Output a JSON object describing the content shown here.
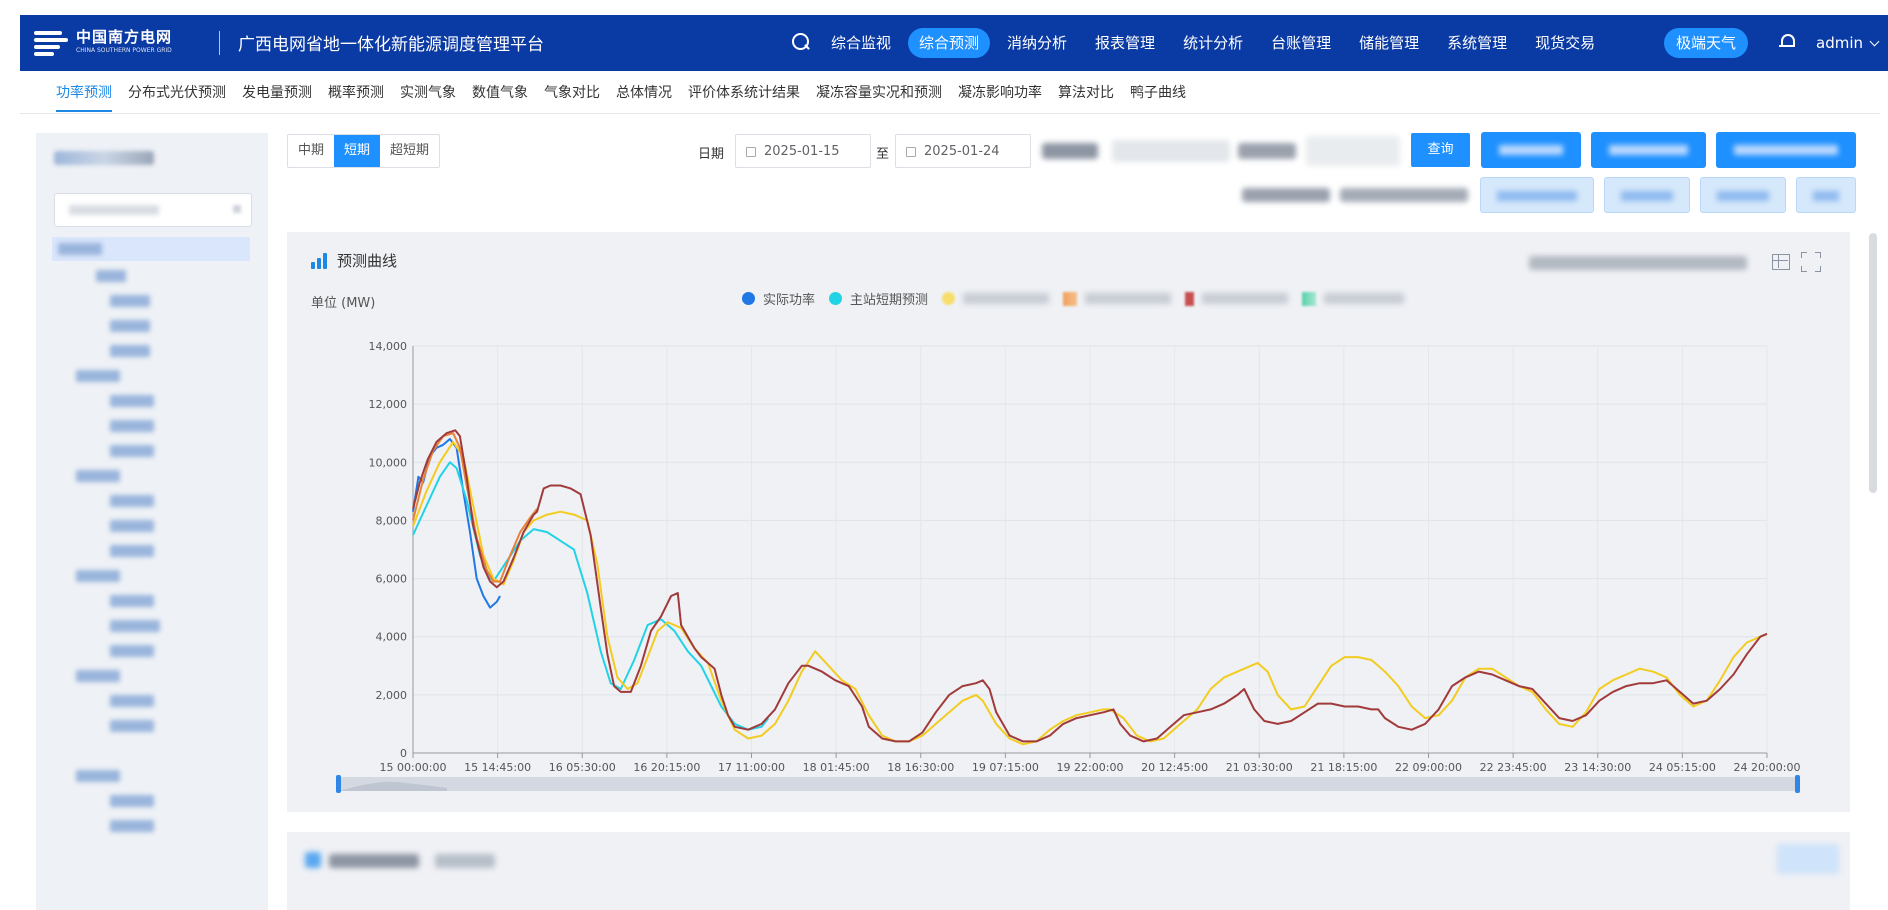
{
  "header": {
    "logo_cn": "中国南方电网",
    "logo_en": "CHINA SOUTHERN POWER GRID",
    "platform_title": "广西电网省地一体化新能源调度管理平台",
    "nav_items": [
      "综合监视",
      "综合预测",
      "消纳分析",
      "报表管理",
      "统计分析",
      "台账管理",
      "储能管理",
      "系统管理",
      "现货交易"
    ],
    "active_nav_index": 1,
    "extreme_weather": "极端天气",
    "user": "admin"
  },
  "subnav": {
    "items": [
      "功率预测",
      "分布式光伏预测",
      "发电量预测",
      "概率预测",
      "实测气象",
      "数值气象",
      "气象对比",
      "总体情况",
      "评价体系统计结果",
      "凝冻容量实况和预测",
      "凝冻影响功率",
      "算法对比",
      "鸭子曲线"
    ],
    "active_index": 0
  },
  "toolbar": {
    "segments": [
      "中期",
      "短期",
      "超短期"
    ],
    "active_segment": 1,
    "date_label": "日期",
    "date_from": "2025-01-15",
    "date_sep": "至",
    "date_to": "2025-01-24",
    "query": "查询"
  },
  "panel": {
    "title": "预测曲线",
    "unit": "单位 (MW)",
    "legend": [
      {
        "name": "实际功率",
        "color": "#1f78e6"
      },
      {
        "name": "主站短期预测",
        "color": "#22d3e6"
      }
    ]
  },
  "chart_data": {
    "type": "line",
    "ylim": [
      0,
      14000
    ],
    "yticks": [
      "0",
      "2,000",
      "4,000",
      "6,000",
      "8,000",
      "10,000",
      "12,000",
      "14,000"
    ],
    "xticks": [
      "15 00:00:00",
      "15 14:45:00",
      "16 05:30:00",
      "16 20:15:00",
      "17 11:00:00",
      "18 01:45:00",
      "18 16:30:00",
      "19 07:15:00",
      "19 22:00:00",
      "20 12:45:00",
      "21 03:30:00",
      "21 18:15:00",
      "22 09:00:00",
      "22 23:45:00",
      "23 14:30:00",
      "24 05:15:00",
      "24 20:00:00"
    ],
    "x_unit": "hours from 15 00:00:00",
    "grid": true,
    "series": [
      {
        "name": "实际功率",
        "color": "#1f78e6",
        "points": [
          [
            0,
            8300
          ],
          [
            0.8,
            9500
          ],
          [
            1.5,
            9300
          ],
          [
            2.5,
            10200
          ],
          [
            3.5,
            10500
          ],
          [
            4.5,
            10600
          ],
          [
            5.5,
            10800
          ],
          [
            6.5,
            10500
          ],
          [
            7.5,
            9000
          ],
          [
            8.5,
            7600
          ],
          [
            9.5,
            6000
          ],
          [
            10.5,
            5400
          ],
          [
            11.5,
            5000
          ],
          [
            12.5,
            5200
          ],
          [
            13,
            5400
          ]
        ]
      },
      {
        "name": "主站短期预测",
        "color": "#22d3e6",
        "points": [
          [
            0,
            7500
          ],
          [
            2,
            8500
          ],
          [
            4,
            9500
          ],
          [
            5.5,
            10000
          ],
          [
            6.5,
            9800
          ],
          [
            8,
            8700
          ],
          [
            10,
            6800
          ],
          [
            11,
            6200
          ],
          [
            12,
            5900
          ],
          [
            14,
            6600
          ],
          [
            16,
            7300
          ],
          [
            18,
            7700
          ],
          [
            20,
            7600
          ],
          [
            22,
            7300
          ],
          [
            24,
            7000
          ],
          [
            26,
            5500
          ],
          [
            28,
            3500
          ],
          [
            29.5,
            2400
          ],
          [
            31,
            2200
          ],
          [
            33,
            3200
          ],
          [
            35,
            4400
          ],
          [
            37,
            4600
          ],
          [
            39,
            4200
          ],
          [
            41,
            3500
          ],
          [
            43,
            3000
          ],
          [
            46,
            1600
          ],
          [
            48,
            1000
          ],
          [
            50,
            800
          ],
          [
            52,
            900
          ],
          [
            53,
            1200
          ]
        ]
      },
      {
        "name": "",
        "color": "#f2cc20",
        "points": [
          [
            0,
            7800
          ],
          [
            2,
            9000
          ],
          [
            4,
            10000
          ],
          [
            6,
            10700
          ],
          [
            7.5,
            10200
          ],
          [
            9,
            8500
          ],
          [
            10.5,
            6800
          ],
          [
            12,
            6000
          ],
          [
            13.5,
            5800
          ],
          [
            15,
            6600
          ],
          [
            16.5,
            7600
          ],
          [
            18,
            8000
          ],
          [
            20,
            8200
          ],
          [
            22,
            8300
          ],
          [
            24,
            8200
          ],
          [
            26,
            8000
          ],
          [
            27.5,
            6500
          ],
          [
            29,
            4000
          ],
          [
            30.5,
            2600
          ],
          [
            32,
            2200
          ],
          [
            33.5,
            2400
          ],
          [
            35,
            3300
          ],
          [
            36.5,
            4200
          ],
          [
            38,
            4500
          ],
          [
            40,
            4300
          ],
          [
            42,
            3600
          ],
          [
            44,
            3100
          ],
          [
            46,
            1800
          ],
          [
            48,
            800
          ],
          [
            50,
            500
          ],
          [
            52,
            600
          ],
          [
            54,
            1000
          ],
          [
            56,
            1800
          ],
          [
            58,
            2800
          ],
          [
            60,
            3500
          ],
          [
            62,
            3000
          ],
          [
            64,
            2500
          ],
          [
            66,
            2200
          ],
          [
            68,
            1300
          ],
          [
            70,
            600
          ],
          [
            72,
            400
          ],
          [
            74,
            400
          ],
          [
            76,
            600
          ],
          [
            78,
            1000
          ],
          [
            80,
            1400
          ],
          [
            82,
            1800
          ],
          [
            84,
            2000
          ],
          [
            85,
            1800
          ],
          [
            87,
            1000
          ],
          [
            89,
            500
          ],
          [
            91,
            300
          ],
          [
            93,
            400
          ],
          [
            95,
            800
          ],
          [
            97,
            1100
          ],
          [
            99,
            1300
          ],
          [
            101,
            1400
          ],
          [
            103,
            1500
          ],
          [
            104,
            1500
          ],
          [
            106,
            1200
          ],
          [
            108,
            600
          ],
          [
            110,
            400
          ],
          [
            112,
            500
          ],
          [
            114,
            900
          ],
          [
            116,
            1300
          ],
          [
            117,
            1500
          ],
          [
            119,
            2200
          ],
          [
            121,
            2600
          ],
          [
            123,
            2800
          ],
          [
            125,
            3000
          ],
          [
            126,
            3100
          ],
          [
            127.5,
            2800
          ],
          [
            129,
            2000
          ],
          [
            131,
            1500
          ],
          [
            133,
            1600
          ],
          [
            135,
            2300
          ],
          [
            137,
            3000
          ],
          [
            139,
            3300
          ],
          [
            141,
            3300
          ],
          [
            143,
            3200
          ],
          [
            145,
            2800
          ],
          [
            147,
            2300
          ],
          [
            149,
            1600
          ],
          [
            151,
            1200
          ],
          [
            153,
            1300
          ],
          [
            155,
            1800
          ],
          [
            157,
            2600
          ],
          [
            159,
            2900
          ],
          [
            161,
            2900
          ],
          [
            163,
            2600
          ],
          [
            165,
            2300
          ],
          [
            167,
            2100
          ],
          [
            169,
            1500
          ],
          [
            171,
            1000
          ],
          [
            173,
            900
          ],
          [
            175,
            1400
          ],
          [
            177,
            2200
          ],
          [
            179,
            2500
          ],
          [
            181,
            2700
          ],
          [
            183,
            2900
          ],
          [
            185,
            2800
          ],
          [
            187,
            2600
          ],
          [
            189,
            2000
          ],
          [
            191,
            1600
          ],
          [
            193,
            1800
          ],
          [
            195,
            2500
          ],
          [
            197,
            3300
          ],
          [
            199,
            3800
          ],
          [
            201,
            4000
          ],
          [
            202,
            4100
          ]
        ]
      },
      {
        "name": "",
        "color": "#e8823a",
        "points": [
          [
            0,
            8000
          ],
          [
            1.5,
            9400
          ],
          [
            3,
            10400
          ],
          [
            4.5,
            10900
          ],
          [
            6,
            11000
          ],
          [
            7,
            10500
          ],
          [
            8,
            9200
          ],
          [
            9.5,
            7400
          ],
          [
            11,
            6300
          ],
          [
            12,
            5900
          ],
          [
            13,
            5900
          ],
          [
            14.5,
            6800
          ],
          [
            16,
            7600
          ],
          [
            17.5,
            8100
          ],
          [
            18.5,
            8400
          ]
        ]
      },
      {
        "name": "",
        "color": "#a13a3a",
        "points": [
          [
            0,
            8400
          ],
          [
            1,
            9300
          ],
          [
            2.2,
            10100
          ],
          [
            3.5,
            10700
          ],
          [
            5,
            11000
          ],
          [
            6.3,
            11100
          ],
          [
            7,
            10900
          ],
          [
            8,
            9500
          ],
          [
            9,
            7800
          ],
          [
            10.5,
            6400
          ],
          [
            11.5,
            5900
          ],
          [
            12.5,
            5700
          ],
          [
            13.5,
            5900
          ],
          [
            15,
            6700
          ],
          [
            16.5,
            7600
          ],
          [
            18,
            8200
          ],
          [
            18.5,
            8300
          ],
          [
            19.5,
            9100
          ],
          [
            20.5,
            9200
          ],
          [
            22,
            9200
          ],
          [
            23.5,
            9100
          ],
          [
            25,
            8900
          ],
          [
            26.5,
            7500
          ],
          [
            28,
            5000
          ],
          [
            29,
            3400
          ],
          [
            30,
            2300
          ],
          [
            31,
            2100
          ],
          [
            32.5,
            2100
          ],
          [
            34,
            3000
          ],
          [
            35.5,
            4200
          ],
          [
            37,
            4700
          ],
          [
            38.5,
            5400
          ],
          [
            39.5,
            5500
          ],
          [
            40,
            4400
          ],
          [
            41,
            4000
          ],
          [
            42,
            3600
          ],
          [
            43,
            3300
          ],
          [
            44,
            3100
          ],
          [
            45,
            2900
          ],
          [
            46,
            2000
          ],
          [
            47,
            1300
          ],
          [
            48,
            900
          ],
          [
            50,
            800
          ],
          [
            52,
            1000
          ],
          [
            54,
            1500
          ],
          [
            56,
            2400
          ],
          [
            58,
            3000
          ],
          [
            59,
            3000
          ],
          [
            61,
            2800
          ],
          [
            63,
            2500
          ],
          [
            65,
            2300
          ],
          [
            67,
            1600
          ],
          [
            68,
            900
          ],
          [
            70,
            500
          ],
          [
            72,
            400
          ],
          [
            74,
            400
          ],
          [
            76,
            700
          ],
          [
            78,
            1400
          ],
          [
            80,
            2000
          ],
          [
            82,
            2300
          ],
          [
            84,
            2400
          ],
          [
            85,
            2500
          ],
          [
            86,
            2200
          ],
          [
            87,
            1400
          ],
          [
            89,
            600
          ],
          [
            91,
            400
          ],
          [
            93,
            400
          ],
          [
            95,
            600
          ],
          [
            97,
            1000
          ],
          [
            99,
            1200
          ],
          [
            101,
            1300
          ],
          [
            103,
            1400
          ],
          [
            104.5,
            1500
          ],
          [
            105.5,
            1000
          ],
          [
            107,
            600
          ],
          [
            109,
            400
          ],
          [
            111,
            500
          ],
          [
            113,
            900
          ],
          [
            115,
            1300
          ],
          [
            117,
            1400
          ],
          [
            119,
            1500
          ],
          [
            121,
            1700
          ],
          [
            123,
            2000
          ],
          [
            124,
            2200
          ],
          [
            125.5,
            1500
          ],
          [
            127,
            1100
          ],
          [
            129,
            1000
          ],
          [
            131,
            1100
          ],
          [
            133,
            1400
          ],
          [
            135,
            1700
          ],
          [
            137,
            1700
          ],
          [
            139,
            1600
          ],
          [
            141,
            1600
          ],
          [
            143,
            1500
          ],
          [
            144,
            1500
          ],
          [
            145,
            1200
          ],
          [
            147,
            900
          ],
          [
            149,
            800
          ],
          [
            151,
            1000
          ],
          [
            153,
            1500
          ],
          [
            155,
            2300
          ],
          [
            157,
            2600
          ],
          [
            159,
            2800
          ],
          [
            161,
            2700
          ],
          [
            163,
            2500
          ],
          [
            165,
            2300
          ],
          [
            167,
            2200
          ],
          [
            169,
            1700
          ],
          [
            171,
            1200
          ],
          [
            173,
            1100
          ],
          [
            175,
            1300
          ],
          [
            177,
            1800
          ],
          [
            179,
            2100
          ],
          [
            181,
            2300
          ],
          [
            183,
            2400
          ],
          [
            185,
            2400
          ],
          [
            187,
            2500
          ],
          [
            189,
            2100
          ],
          [
            191,
            1700
          ],
          [
            193,
            1800
          ],
          [
            195,
            2200
          ],
          [
            197,
            2700
          ],
          [
            199,
            3400
          ],
          [
            201,
            4000
          ],
          [
            202,
            4100
          ]
        ]
      }
    ]
  }
}
